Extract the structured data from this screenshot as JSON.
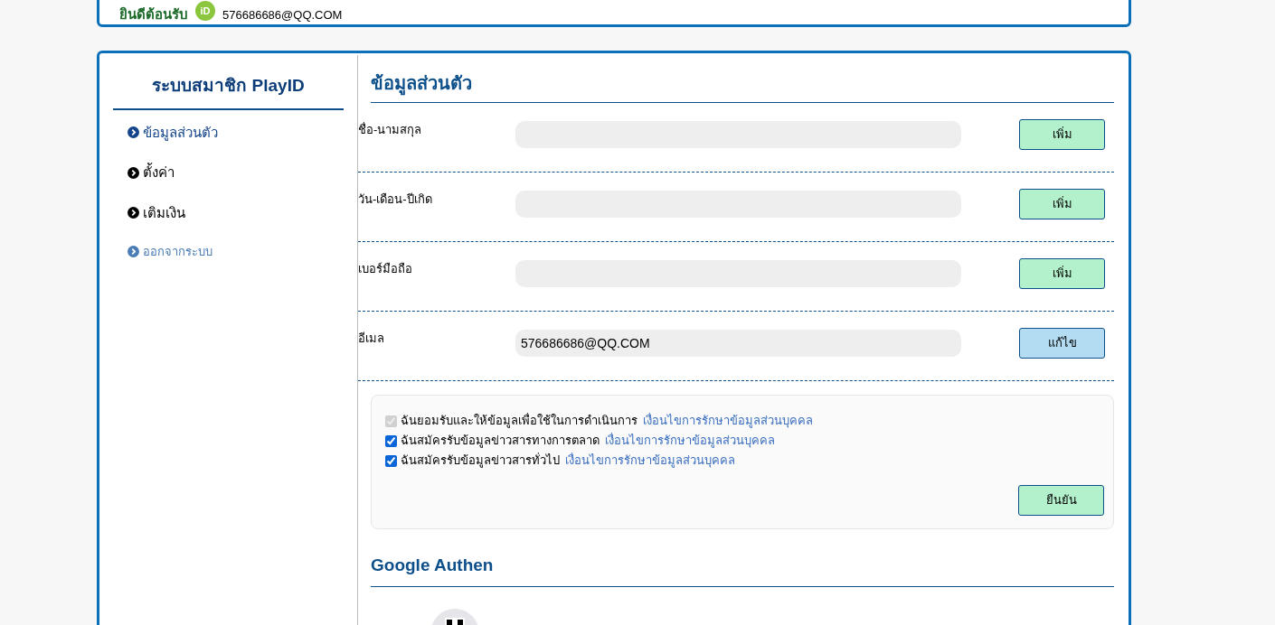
{
  "header": {
    "greeting": "ยินดีต้อนรับ",
    "badge": "iD",
    "email": "576686686@QQ.COM"
  },
  "sidebar": {
    "title": "ระบบสมาชิก PlayID",
    "items": [
      {
        "label": "ข้อมูลส่วนตัว",
        "selected": true,
        "kind": "main"
      },
      {
        "label": "ตั้งค่า",
        "selected": false,
        "kind": "main"
      },
      {
        "label": "เติมเงิน",
        "selected": false,
        "kind": "main"
      },
      {
        "label": "ออกจากระบบ",
        "selected": false,
        "kind": "logout"
      }
    ]
  },
  "profile": {
    "title": "ข้อมูลส่วนตัว",
    "fields": [
      {
        "label": "ชื่อ-นามสกุล",
        "button": "เพิ่ม",
        "kind": "add"
      },
      {
        "label": "วัน-เดือน-ปีเกิด",
        "button": "เพิ่ม",
        "kind": "add"
      },
      {
        "label": "เบอร์มือถือ",
        "button": "เพิ่ม",
        "kind": "add"
      },
      {
        "label": "อีเมล",
        "value": "576686686@QQ.COM",
        "button": "แก้ไข",
        "kind": "edit"
      }
    ]
  },
  "consent": {
    "items": [
      {
        "label": "ฉันยอมรับและให้ข้อมูลเพื่อใช้ในการดำเนินการ",
        "link": "เงื่อนไขการรักษาข้อมูลส่วนบุคคล",
        "checked": true,
        "disabled": true
      },
      {
        "label": "ฉันสมัครรับข้อมูลข่าวสารทางการตลาด",
        "link": "เงื่อนไขการรักษาข้อมูลส่วนบุคคล",
        "checked": true,
        "disabled": false
      },
      {
        "label": "ฉันสมัครรับข้อมูลข่าวสารทั่วไป",
        "link": "เงื่อนไขการรักษาข้อมูลส่วนบุคคล",
        "checked": true,
        "disabled": false
      }
    ],
    "button": "ยืนยัน"
  },
  "google_authen": {
    "title": "Google Authen"
  }
}
